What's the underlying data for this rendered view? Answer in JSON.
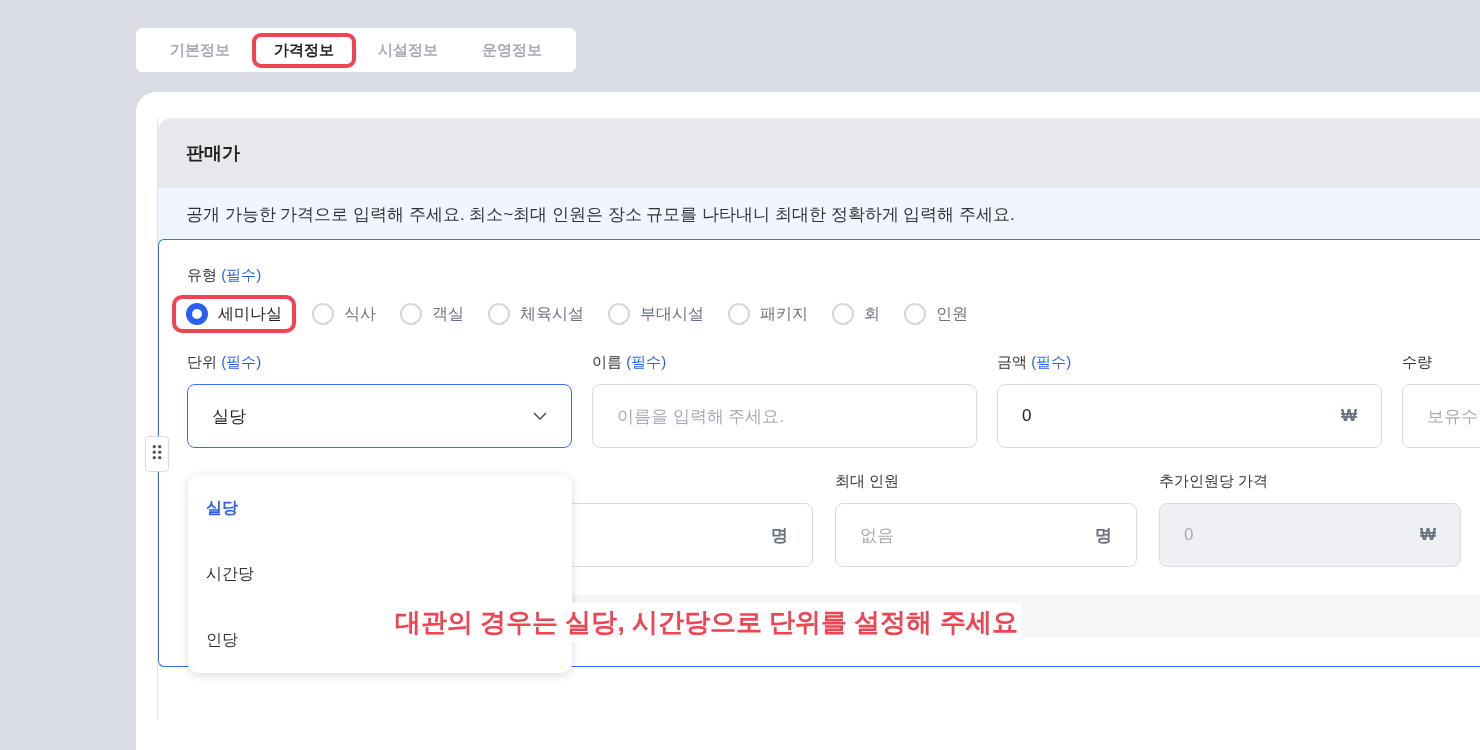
{
  "tabs": [
    {
      "label": "기본정보",
      "selected": false,
      "highlighted": false
    },
    {
      "label": "가격정보",
      "selected": true,
      "highlighted": true
    },
    {
      "label": "시설정보",
      "selected": false,
      "highlighted": false
    },
    {
      "label": "운영정보",
      "selected": false,
      "highlighted": false
    }
  ],
  "section": {
    "title": "판매가",
    "notice": "공개 가능한 가격으로 입력해 주세요. 최소~최대 인원은 장소 규모를 나타내니 최대한 정확하게 입력해 주세요."
  },
  "type_field": {
    "label": "유형",
    "required": "(필수)",
    "options": [
      {
        "label": "세미나실",
        "selected": true,
        "highlighted": true
      },
      {
        "label": "식사",
        "selected": false,
        "highlighted": false
      },
      {
        "label": "객실",
        "selected": false,
        "highlighted": false
      },
      {
        "label": "체육시설",
        "selected": false,
        "highlighted": false
      },
      {
        "label": "부대시설",
        "selected": false,
        "highlighted": false
      },
      {
        "label": "패키지",
        "selected": false,
        "highlighted": false
      },
      {
        "label": "회",
        "selected": false,
        "highlighted": false
      },
      {
        "label": "인원",
        "selected": false,
        "highlighted": false
      }
    ]
  },
  "fields_row_1": [
    {
      "kind": "select",
      "label": "단위",
      "required": "(필수)",
      "value": "실당",
      "open": true
    },
    {
      "kind": "text",
      "label": "이름",
      "required": "(필수)",
      "placeholder": "이름을 입력해 주세요."
    },
    {
      "kind": "text",
      "label": "금액",
      "required": "(필수)",
      "value": "0",
      "suffix": "₩"
    },
    {
      "kind": "text",
      "label": "수량",
      "placeholder": "보유수"
    }
  ],
  "fields_row_2": [
    {
      "kind": "text",
      "suffix": "명",
      "disabled": false
    },
    {
      "kind": "text",
      "label": "최대 인원",
      "placeholder": "없음",
      "suffix": "명",
      "disabled": false
    },
    {
      "kind": "text",
      "label": "추가인원당 가격",
      "placeholder": "0",
      "suffix": "₩",
      "disabled": true
    }
  ],
  "dropdown": {
    "options": [
      {
        "label": "실당",
        "selected": true
      },
      {
        "label": "시간당",
        "selected": false
      },
      {
        "label": "인당",
        "selected": false
      }
    ]
  },
  "annotation": "대관의 경우는 실당, 시간당으로 단위를 설정해 주세요"
}
